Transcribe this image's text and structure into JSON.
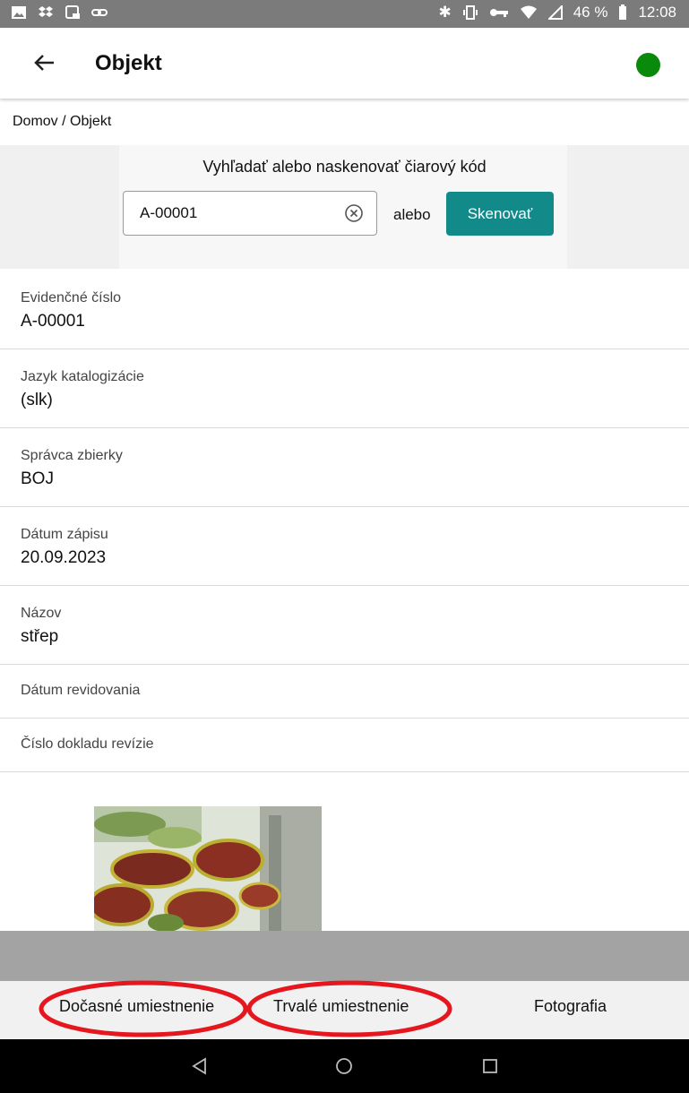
{
  "status_bar": {
    "battery": "46 %",
    "time": "12:08"
  },
  "app_bar": {
    "title": "Objekt",
    "status_color": "#0a8a0a"
  },
  "breadcrumb": "Domov / Objekt",
  "search": {
    "label": "Vyhľadať alebo naskenovať čiarový kód",
    "value": "A-00001",
    "or_text": "alebo",
    "scan_label": "Skenovať",
    "accent": "#138a8a"
  },
  "fields": [
    {
      "label": "Evidenčné číslo",
      "value": "A-00001"
    },
    {
      "label": "Jazyk katalogizácie",
      "value": "(slk)"
    },
    {
      "label": "Správca zbierky",
      "value": "BOJ"
    },
    {
      "label": "Dátum zápisu",
      "value": "20.09.2023"
    },
    {
      "label": "Názov",
      "value": "střep"
    },
    {
      "label": "Dátum revidovania",
      "value": ""
    },
    {
      "label": "Číslo dokladu revízie",
      "value": ""
    }
  ],
  "tabs": {
    "temporary": "Dočasné umiestnenie",
    "permanent": "Trvalé umiestnenie",
    "photo": "Fotografia",
    "highlight_color": "#e5161d"
  },
  "icons": {
    "back": "arrow-left-icon",
    "clear": "clear-circle-icon",
    "nav_back": "triangle-back-icon",
    "nav_home": "circle-home-icon",
    "nav_recents": "square-recents-icon"
  }
}
